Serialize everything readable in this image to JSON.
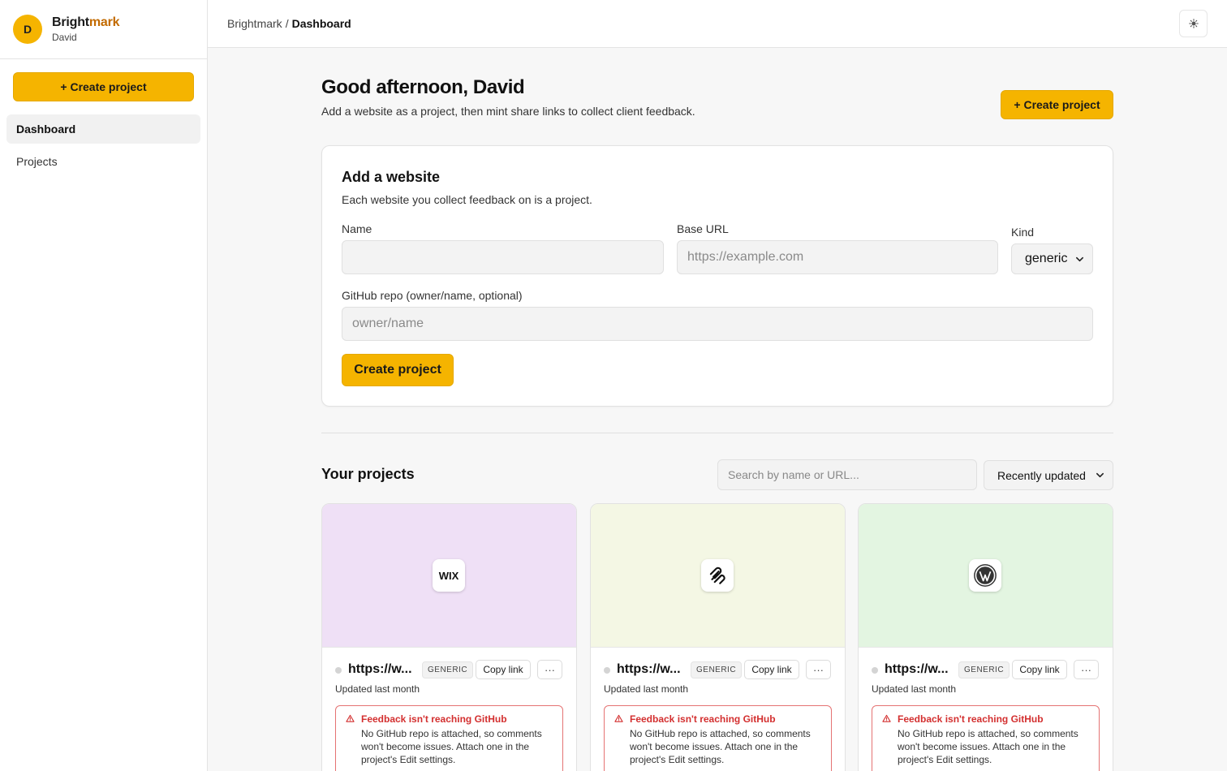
{
  "sidebar": {
    "avatar_initial": "D",
    "brand_main": "Bright",
    "brand_accent": "mark",
    "user_name": "David",
    "create_label": "+ Create project",
    "nav": [
      {
        "label": "Dashboard",
        "active": true
      },
      {
        "label": "Projects",
        "active": false
      }
    ]
  },
  "topbar": {
    "breadcrumb_root": "Brightmark",
    "breadcrumb_sep": "/",
    "breadcrumb_current": "Dashboard",
    "theme_icon": "sun-icon"
  },
  "main": {
    "greeting": "Good afternoon, David",
    "subtitle": "Add a website as a project, then mint share links to collect client feedback.",
    "create_label": "+ Create project"
  },
  "form": {
    "title": "Add a website",
    "subtitle": "Each website you collect feedback on is a project.",
    "name_label": "Name",
    "name_value": "",
    "url_label": "Base URL",
    "url_placeholder": "https://example.com",
    "kind_label": "Kind",
    "kind_value": "generic",
    "repo_label": "GitHub repo (owner/name, optional)",
    "repo_placeholder": "owner/name",
    "submit_label": "Create project"
  },
  "projects": {
    "title": "Your projects",
    "search_placeholder": "Search by name or URL...",
    "sort_value": "Recently updated",
    "items": [
      {
        "logo": "WIX",
        "thumb_color": "#efe0f6",
        "url": "https://w...",
        "badge": "GENERIC",
        "copy_label": "Copy link",
        "more_label": "···",
        "updated": "Updated last month",
        "warn_title": "Feedback isn't reaching GitHub",
        "warn_body": "No GitHub repo is attached, so comments won't become issues. Attach one in the project's Edit settings."
      },
      {
        "logo": "squarespace-icon",
        "thumb_color": "#f4f7e4",
        "url": "https://w...",
        "badge": "GENERIC",
        "copy_label": "Copy link",
        "more_label": "···",
        "updated": "Updated last month",
        "warn_title": "Feedback isn't reaching GitHub",
        "warn_body": "No GitHub repo is attached, so comments won't become issues. Attach one in the project's Edit settings."
      },
      {
        "logo": "wordpress-icon",
        "thumb_color": "#e3f5e1",
        "url": "https://w...",
        "badge": "GENERIC",
        "copy_label": "Copy link",
        "more_label": "···",
        "updated": "Updated last month",
        "warn_title": "Feedback isn't reaching GitHub",
        "warn_body": "No GitHub repo is attached, so comments won't become issues. Attach one in the project's Edit settings."
      }
    ]
  },
  "colors": {
    "accent": "#f5b400",
    "brand_accent": "#c26a00",
    "warning": "#d32f2f"
  }
}
